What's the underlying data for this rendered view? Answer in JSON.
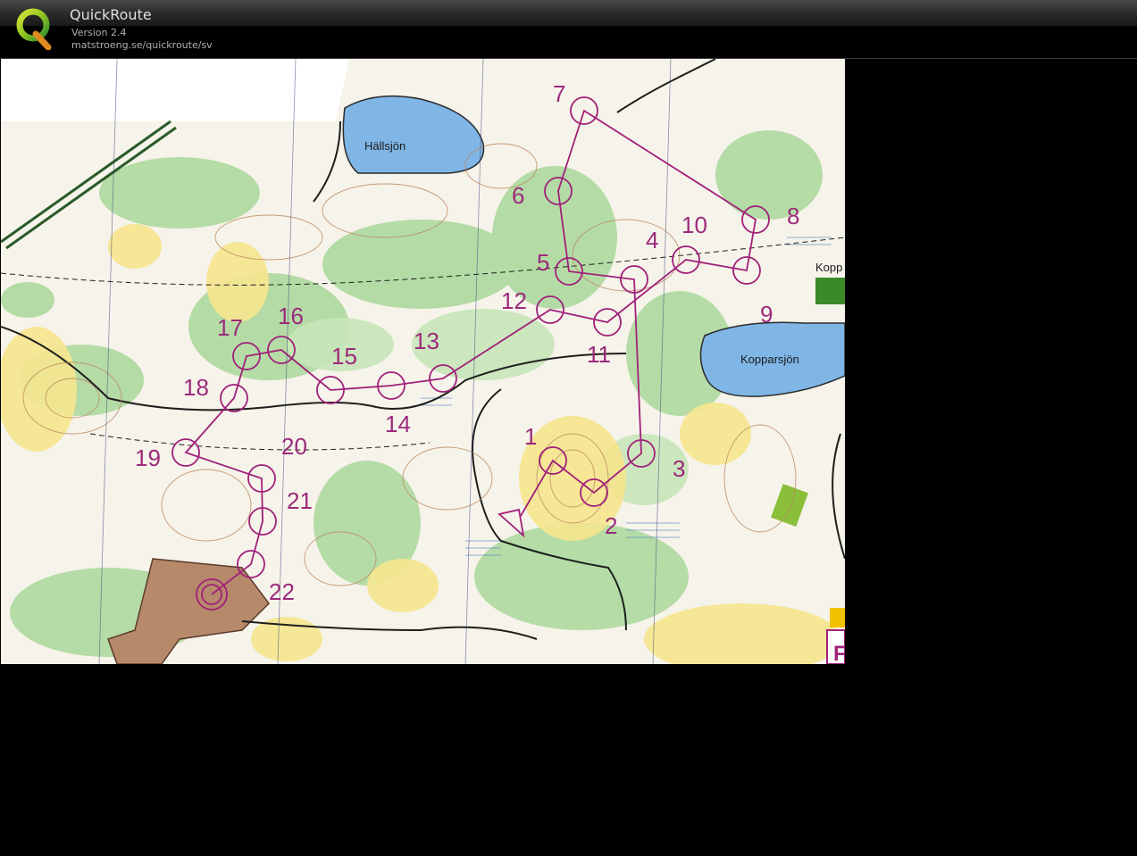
{
  "app": {
    "title": "QuickRoute",
    "version": "Version 2.4",
    "url": "matstroeng.se/quickroute/sv"
  },
  "map": {
    "places": {
      "lake1": "Hällsjön",
      "lake2": "Kopparsjön",
      "village": "Kopp"
    },
    "corner_letter": "F",
    "control_labels": [
      "1",
      "2",
      "3",
      "4",
      "5",
      "6",
      "7",
      "8",
      "9",
      "10",
      "11",
      "12",
      "13",
      "14",
      "15",
      "16",
      "17",
      "18",
      "19",
      "20",
      "21",
      "22"
    ],
    "course_color": "#a0207a"
  }
}
